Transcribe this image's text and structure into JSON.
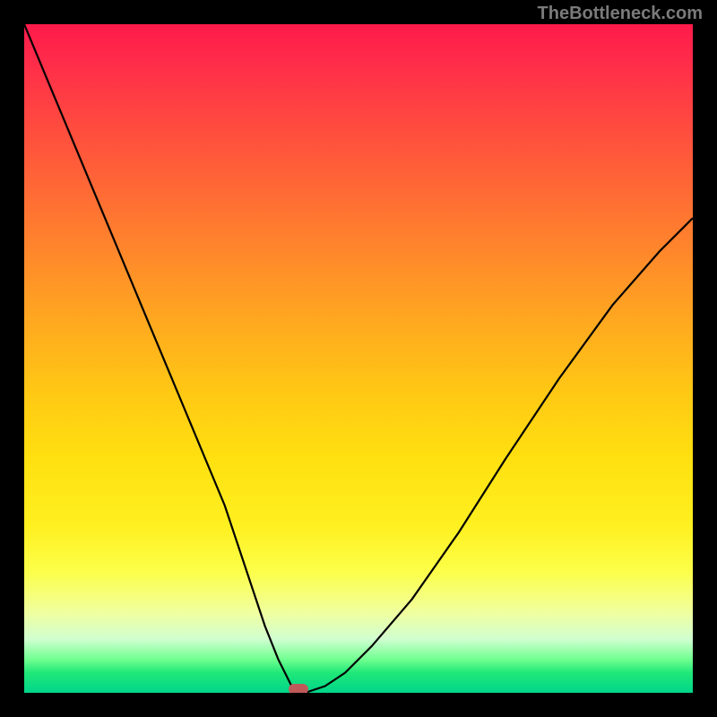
{
  "watermark": "TheBottleneck.com",
  "chart_data": {
    "type": "line",
    "title": "",
    "xlabel": "",
    "ylabel": "",
    "xlim": [
      0,
      100
    ],
    "ylim": [
      0,
      100
    ],
    "grid": false,
    "background": "rainbow-gradient-vertical",
    "series": [
      {
        "name": "bottleneck-curve",
        "color": "#000000",
        "x": [
          0,
          5,
          10,
          15,
          20,
          25,
          30,
          33,
          36,
          38,
          40,
          41,
          42,
          45,
          48,
          52,
          58,
          65,
          72,
          80,
          88,
          95,
          100
        ],
        "y": [
          100,
          88,
          76,
          64,
          52,
          40,
          28,
          19,
          10,
          5,
          1,
          0,
          0,
          1,
          3,
          7,
          14,
          24,
          35,
          47,
          58,
          66,
          71
        ]
      }
    ],
    "marker": {
      "x": 41,
      "y": 0.5,
      "color": "#c05a5a",
      "shape": "pill"
    },
    "gradient_stops": [
      {
        "pos": 0,
        "color": "#ff1a4a"
      },
      {
        "pos": 25,
        "color": "#ff6a35"
      },
      {
        "pos": 50,
        "color": "#ffc814"
      },
      {
        "pos": 75,
        "color": "#fcff4a"
      },
      {
        "pos": 92,
        "color": "#d0ffd0"
      },
      {
        "pos": 100,
        "color": "#00d68a"
      }
    ]
  }
}
